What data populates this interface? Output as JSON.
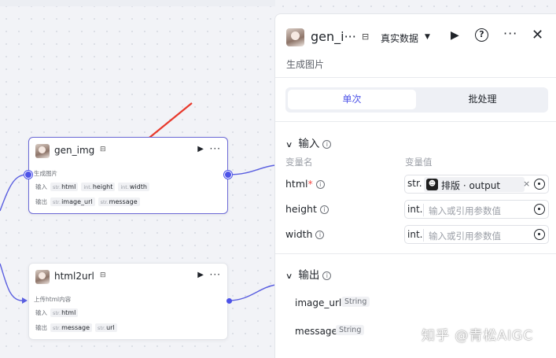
{
  "node_gen_img": {
    "title": "gen_img",
    "description": "生成图片",
    "input_label": "输入",
    "output_label": "输出",
    "inputs": [
      {
        "type": "str.",
        "name": "html"
      },
      {
        "type": "int.",
        "name": "height"
      },
      {
        "type": "int.",
        "name": "width"
      }
    ],
    "outputs": [
      {
        "type": "str.",
        "name": "image_url"
      },
      {
        "type": "str.",
        "name": "message"
      }
    ]
  },
  "node_html2url": {
    "title": "html2url",
    "description": "上传html内容",
    "input_label": "输入",
    "output_label": "输出",
    "inputs": [
      {
        "type": "str.",
        "name": "html"
      }
    ],
    "outputs": [
      {
        "type": "str.",
        "name": "message"
      },
      {
        "type": "str.",
        "name": "url"
      }
    ]
  },
  "panel": {
    "title": "gen_i···",
    "mode": "真实数据",
    "description": "生成图片",
    "tabs": [
      "单次",
      "批处理"
    ],
    "input_section": "输入",
    "output_section": "输出",
    "col_name": "变量名",
    "col_value": "变量值",
    "params": [
      {
        "name": "html",
        "required": "*",
        "type": "str.",
        "ref_text": "排版 · output"
      },
      {
        "name": "height",
        "required": "",
        "type": "int.",
        "placeholder": "输入或引用参数值"
      },
      {
        "name": "width",
        "required": "",
        "type": "int.",
        "placeholder": "输入或引用参数值"
      }
    ],
    "outputs": [
      {
        "name": "image_url",
        "type": "String"
      },
      {
        "name": "message",
        "type": "String"
      }
    ]
  },
  "watermark": "知乎 @青松AIGC",
  "colors": {
    "accent": "#4d53e8",
    "annotation_arrow": "#e8392c"
  },
  "icons": {
    "play": "▶",
    "more": "···",
    "close": "✕",
    "caret": "▼",
    "chevron": "∨",
    "store": "⊟"
  }
}
